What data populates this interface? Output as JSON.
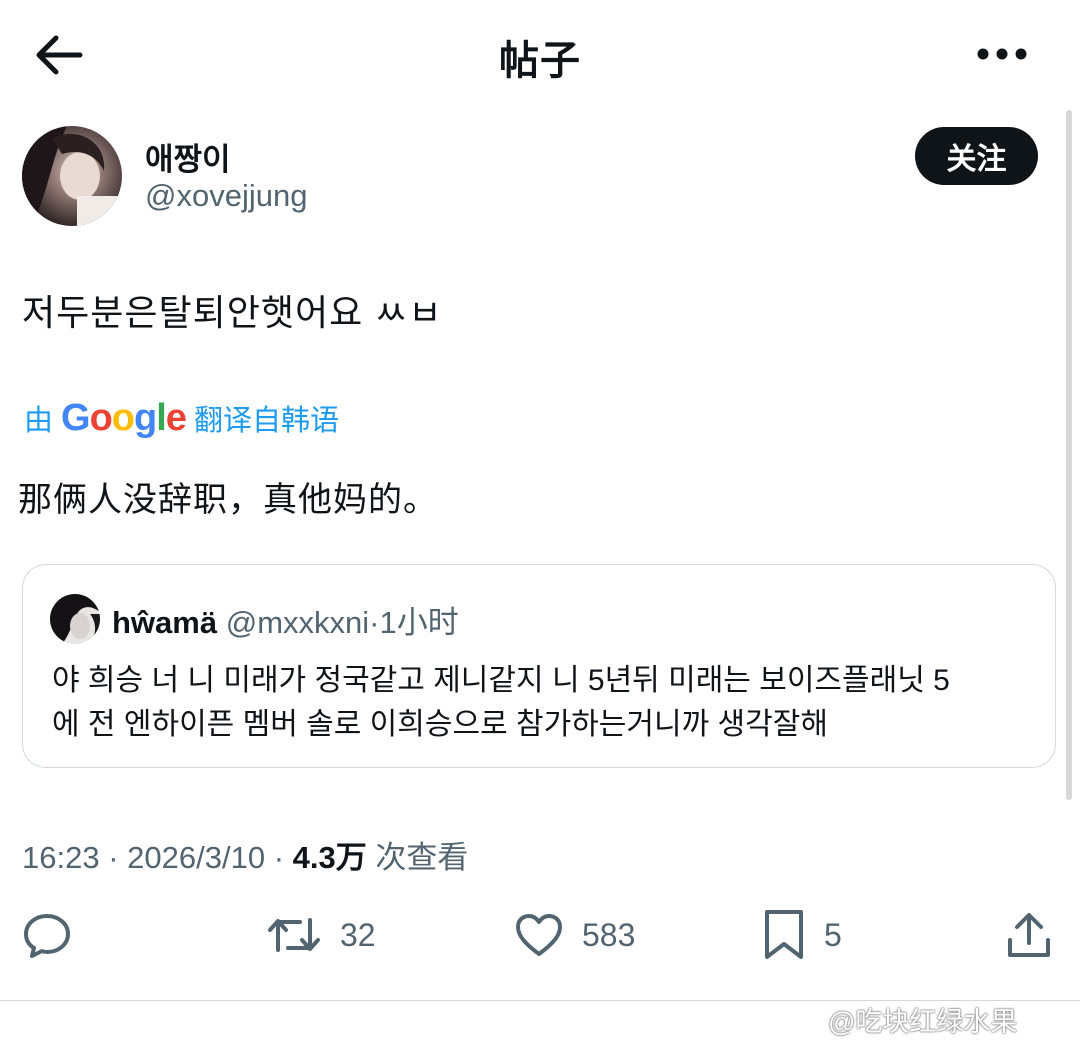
{
  "header": {
    "title": "帖子",
    "back_icon": "arrow-left-icon",
    "more_icon": "more-horizontal-icon"
  },
  "author": {
    "display_name": "애짱이",
    "handle": "@xovejjung",
    "follow_label": "关注"
  },
  "post": {
    "text": "저두분은탈퇴안햇어요 ㅆㅂ",
    "translation_prefix": "由",
    "translation_brand": "Google",
    "translation_suffix": "翻译自韩语",
    "translated_text": "那俩人没辞职，真他妈的。"
  },
  "quote": {
    "name": "hŵamä",
    "handle": "@mxxkxni",
    "separator": "·",
    "time": "1小时",
    "lines": [
      "야 희승 너 니 미래가 정국같고 제니같지 니 5년뒤 미래는 보이즈플래닛 5",
      "에 전 엔하이픈 멤버 솔로 이희승으로 참가하는거니까 생각잘해"
    ]
  },
  "meta": {
    "time": "16:23",
    "date": "2026/3/10",
    "separator": "·",
    "views": "4.3万",
    "views_label": "次查看"
  },
  "actions": {
    "reply_icon": "reply-icon",
    "retweet_icon": "retweet-icon",
    "retweets": "32",
    "like_icon": "heart-icon",
    "likes": "583",
    "bookmark_icon": "bookmark-icon",
    "bookmarks": "5",
    "share_icon": "share-icon"
  },
  "watermark": "@吃块红绿水果",
  "colors": {
    "text": "#0f1419",
    "secondary": "#536471",
    "link": "#1d9bf0",
    "border": "#cfd9de",
    "follow_bg": "#0f1419"
  }
}
